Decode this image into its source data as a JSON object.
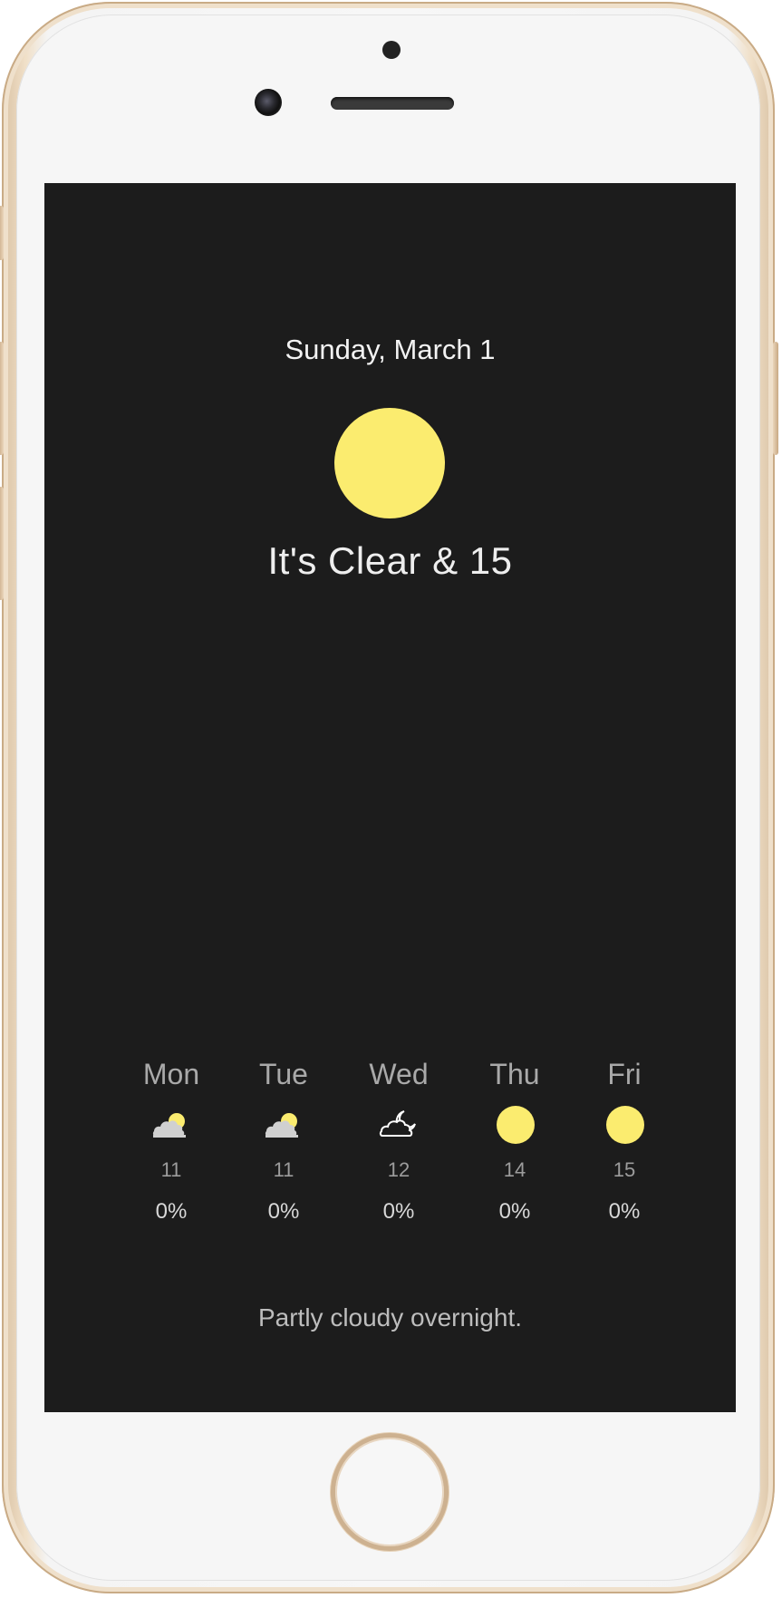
{
  "current": {
    "date": "Sunday, March 1",
    "summary": "It's Clear & 15",
    "icon": "clear-day-icon",
    "sun_color": "#fbec6f"
  },
  "forecast": [
    {
      "day": "Mon",
      "icon": "partly-cloudy-day-icon",
      "temp": "11",
      "precip": "0%"
    },
    {
      "day": "Tue",
      "icon": "partly-cloudy-day-icon",
      "temp": "11",
      "precip": "0%"
    },
    {
      "day": "Wed",
      "icon": "partly-cloudy-night-icon",
      "temp": "12",
      "precip": "0%"
    },
    {
      "day": "Thu",
      "icon": "clear-day-icon",
      "temp": "14",
      "precip": "0%"
    },
    {
      "day": "Fri",
      "icon": "clear-day-icon",
      "temp": "15",
      "precip": "0%"
    }
  ],
  "description": "Partly cloudy overnight.",
  "colors": {
    "screen_background": "#1c1c1c",
    "sun": "#fbec6f",
    "cloud": "#d0d0d0"
  }
}
